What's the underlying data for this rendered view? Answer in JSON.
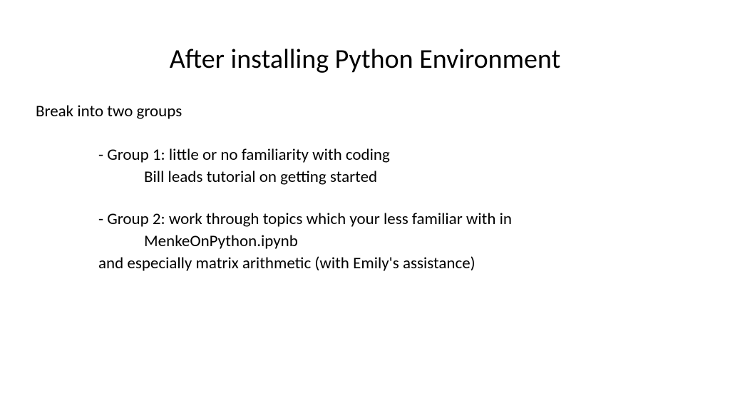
{
  "slide": {
    "title": "After installing Python Environment",
    "intro": "Break into two groups",
    "group1": {
      "header": "- Group 1:  little or no familiarity with coding",
      "detail": "Bill leads tutorial on getting started"
    },
    "group2": {
      "header": "- Group 2:  work through topics which your less familiar with in",
      "detail": "MenkeOnPython.ipynb",
      "footer": "and especially matrix arithmetic (with Emily's assistance)"
    }
  }
}
